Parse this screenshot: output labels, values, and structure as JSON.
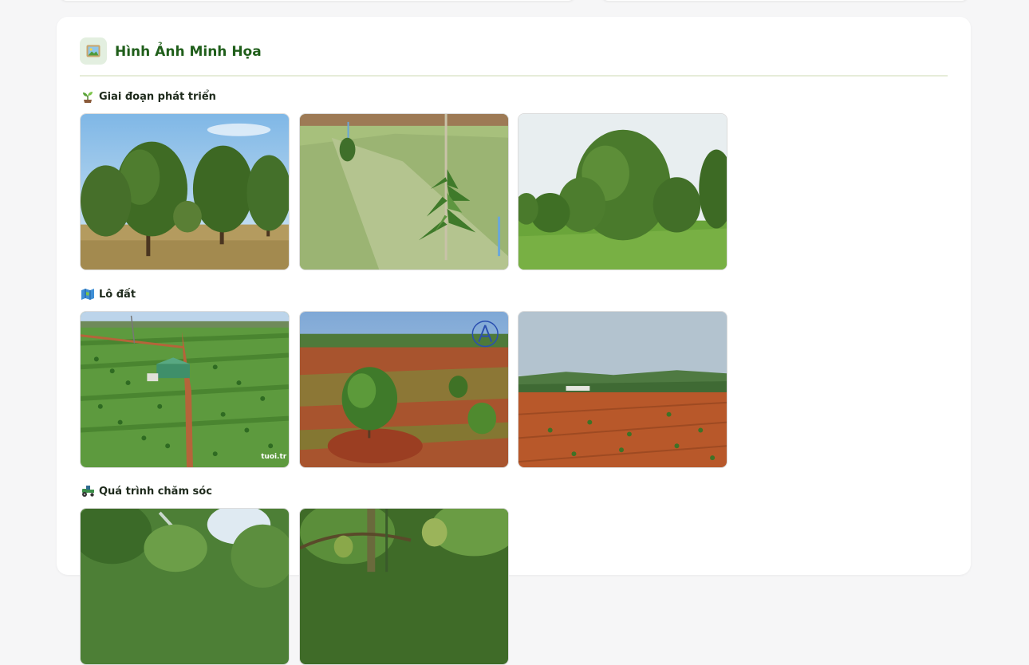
{
  "gallery": {
    "title": "Hình Ảnh Minh Họa",
    "header_icon": "framed-picture-icon",
    "sections": [
      {
        "label": "Giai đoạn phát triển",
        "icon": "seedling-icon",
        "photos": [
          "mature-durian-trees-photo",
          "young-durian-sapling-photo",
          "durian-orchard-photo"
        ]
      },
      {
        "label": "Lô đất",
        "icon": "map-icon",
        "photos": [
          "aerial-farm-plot-photo",
          "red-soil-sapling-photo",
          "cleared-red-soil-field-photo"
        ]
      },
      {
        "label": "Quá trình chăm sóc",
        "icon": "tractor-icon",
        "photos": [
          "irrigation-spraying-photo",
          "durian-fruit-branch-photo"
        ]
      }
    ],
    "watermark_text": "tuoi.tr"
  },
  "colors": {
    "title_green": "#1f5e1a",
    "page_bg": "#f6f6f7",
    "divider": "#e6ecd9"
  }
}
